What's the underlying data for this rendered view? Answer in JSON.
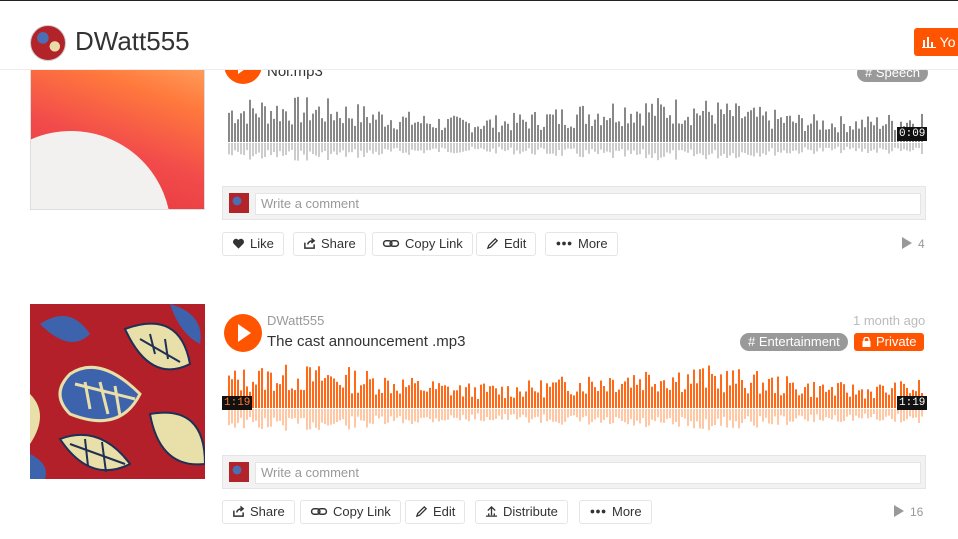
{
  "header": {
    "username": "DWatt555",
    "cta_label": "Yo"
  },
  "track1": {
    "title": "Noi.mp3",
    "tag": "# Speech",
    "time_right": "0:09",
    "comment_placeholder": "Write a comment",
    "buttons": {
      "like": "Like",
      "share": "Share",
      "copy_link": "Copy Link",
      "edit": "Edit",
      "more": "More"
    },
    "plays": "4"
  },
  "track2": {
    "uploader": "DWatt555",
    "date": "1 month ago",
    "title": "The cast announcement .mp3",
    "tag": "# Entertainment",
    "private_label": "Private",
    "time_left": "1:19",
    "time_right": "1:19",
    "comment_placeholder": "Write a comment",
    "buttons": {
      "share": "Share",
      "copy_link": "Copy Link",
      "edit": "Edit",
      "distribute": "Distribute",
      "more": "More"
    },
    "plays": "16"
  },
  "colors": {
    "accent": "#ff5500",
    "wave_gray": "#888888",
    "wave_orange": "#ff6a1a"
  }
}
